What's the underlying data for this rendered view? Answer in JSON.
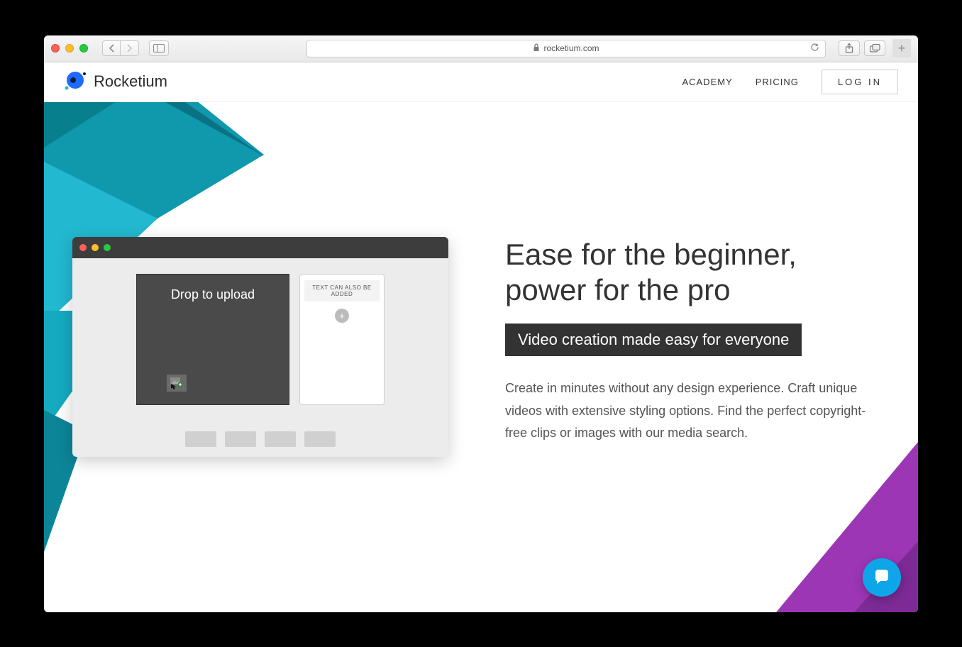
{
  "browser": {
    "url_host": "rocketium.com"
  },
  "header": {
    "brand": "Rocketium",
    "nav": {
      "academy": "ACADEMY",
      "pricing": "PRICING",
      "login": "LOG IN"
    }
  },
  "hero": {
    "headline_line1": "Ease for the beginner,",
    "headline_line2": "power for the pro",
    "subhead": "Video creation made easy for everyone",
    "body": "Create in minutes without any design experience. Craft unique videos with extensive styling options. Find the perfect copyright-free clips or images with our media search."
  },
  "editor": {
    "drop_label": "Drop to upload",
    "side_note": "TEXT CAN ALSO BE ADDED"
  },
  "colors": {
    "teal_dark": "#0b7285",
    "teal_mid": "#1098ad",
    "teal_light": "#22b8cf",
    "purple": "#9c36b5",
    "chat": "#1fb6ff"
  }
}
